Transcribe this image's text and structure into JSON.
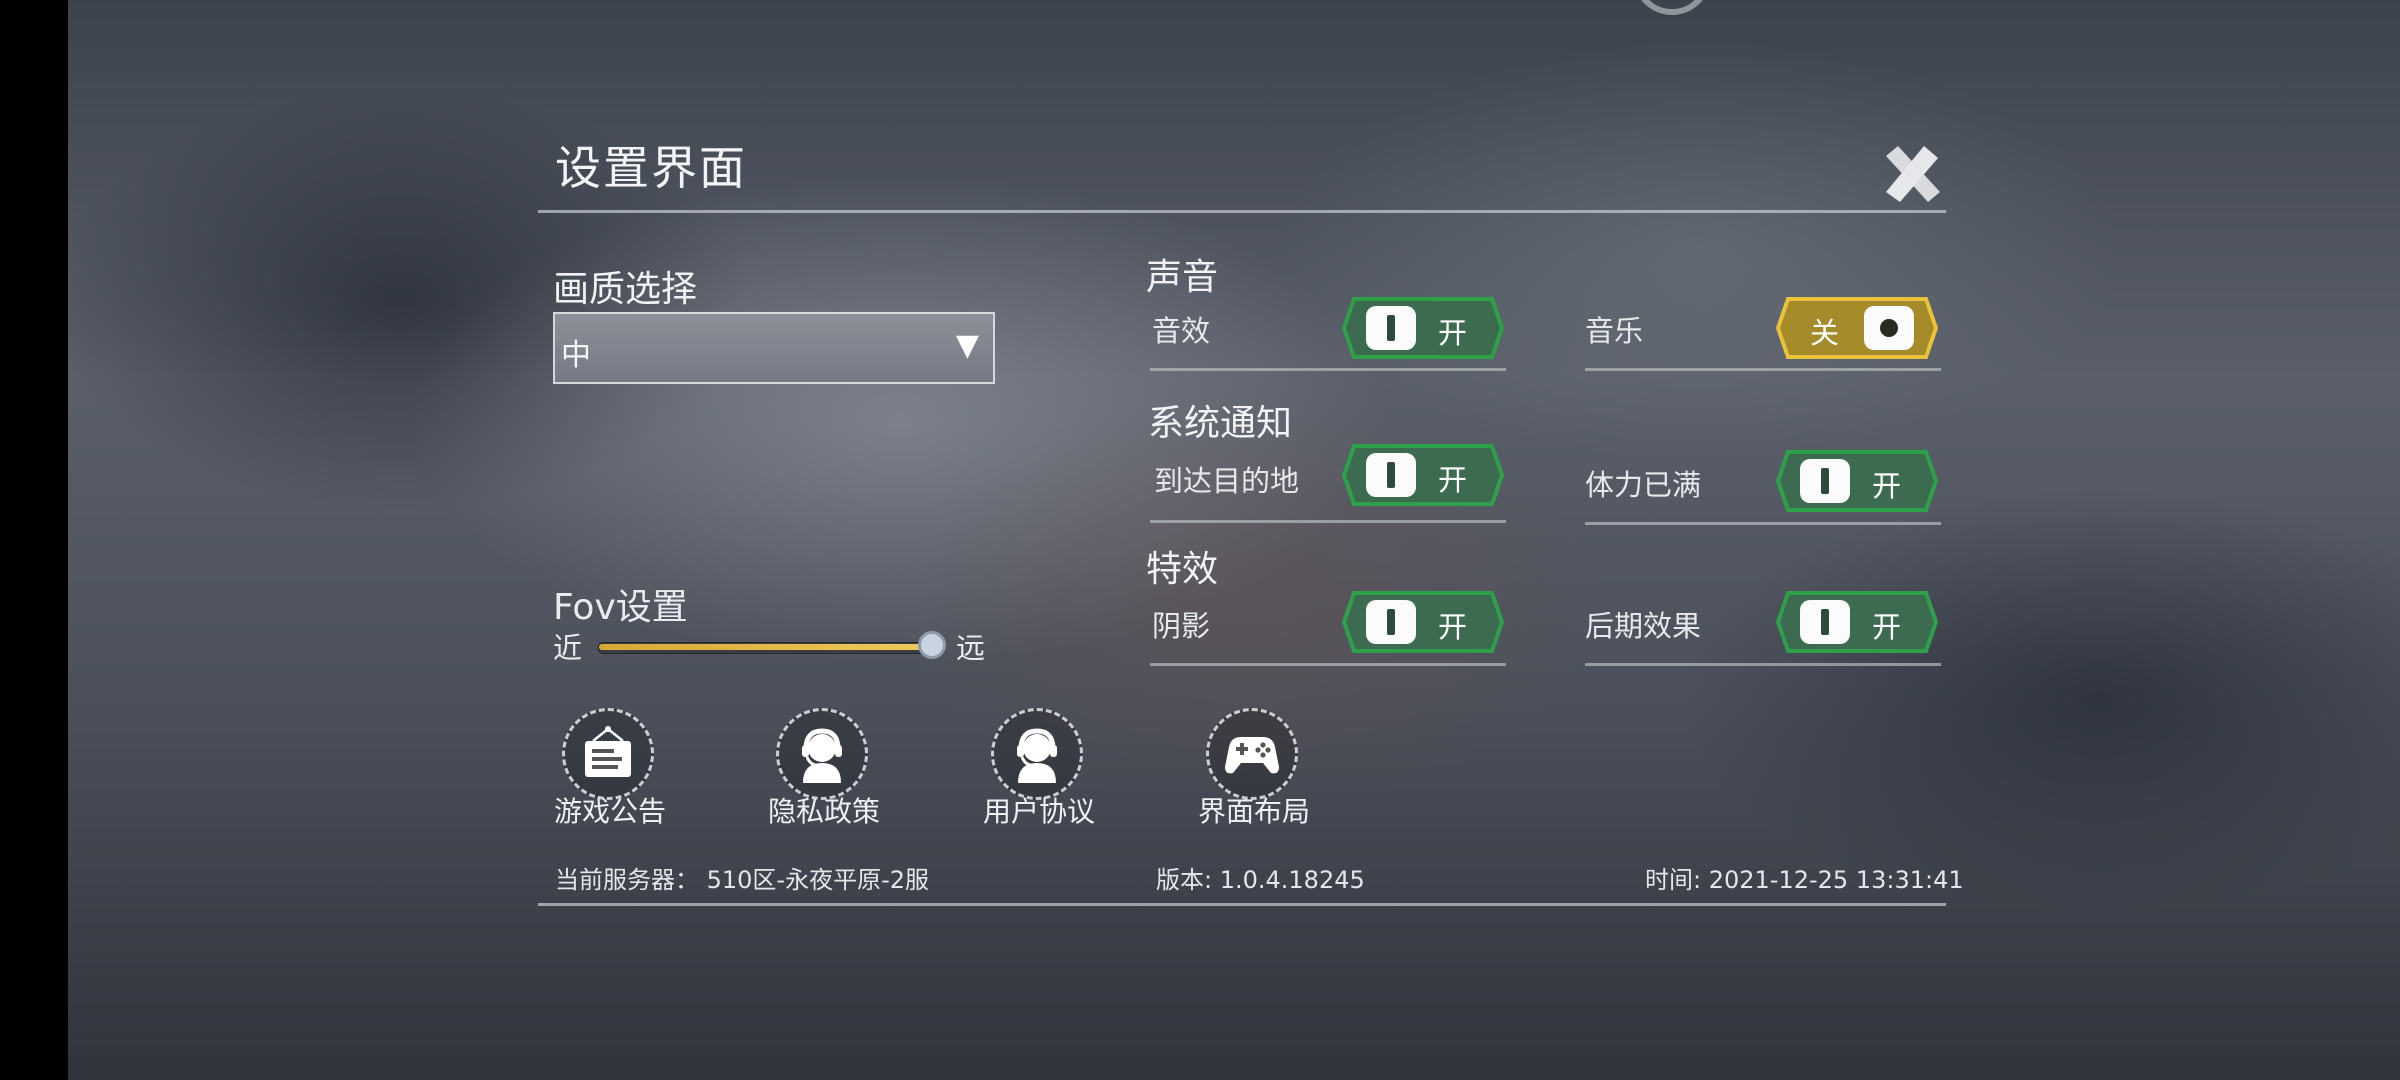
{
  "title": "设置界面",
  "quality": {
    "label": "画质选择",
    "selected": "中"
  },
  "fov": {
    "label": "Fov设置",
    "near": "近",
    "far": "远",
    "level": 1.0
  },
  "sound": {
    "label": "声音",
    "sfx": {
      "label": "音效",
      "state": "开"
    },
    "music": {
      "label": "音乐",
      "state": "关"
    }
  },
  "notify": {
    "label": "系统通知",
    "arrive": {
      "label": "到达目的地",
      "state": "开"
    },
    "stamina": {
      "label": "体力已满",
      "state": "开"
    }
  },
  "effects": {
    "label": "特效",
    "shadow": {
      "label": "阴影",
      "state": "开"
    },
    "post": {
      "label": "后期效果",
      "state": "开"
    }
  },
  "buttons": {
    "announce": "游戏公告",
    "privacy": "隐私政策",
    "agreement": "用户协议",
    "layout": "界面布局"
  },
  "footer": {
    "server": "当前服务器：  510区-永夜平原-2服",
    "version": "版本: 1.0.4.18245",
    "time": "时间: 2021-12-25 13:31:41"
  },
  "colors": {
    "on": "#3c6b50",
    "on_border": "#2ea04a",
    "off": "#a58b2a",
    "off_border": "#e8c23a",
    "slider": "#e0b84a"
  },
  "icons": [
    "close-icon",
    "announcement-icon",
    "privacy-icon",
    "agreement-icon",
    "gamepad-icon"
  ]
}
